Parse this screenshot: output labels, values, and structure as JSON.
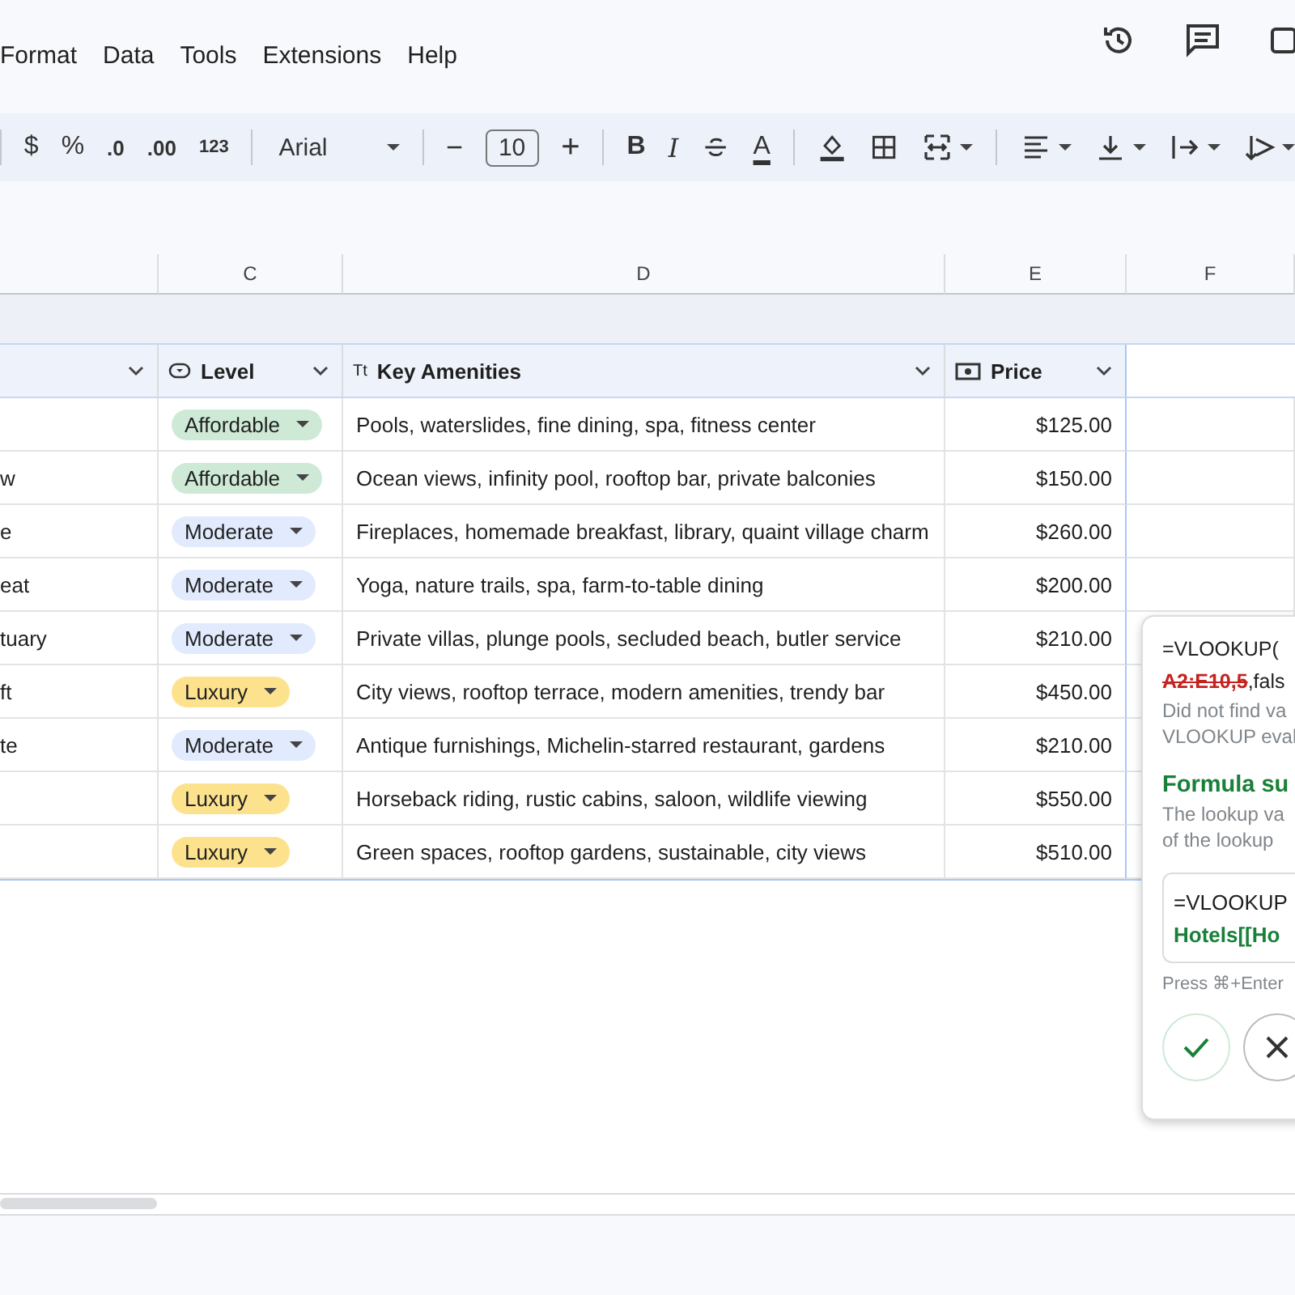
{
  "menu": [
    "Format",
    "Data",
    "Tools",
    "Extensions",
    "Help"
  ],
  "toolbar": {
    "currency": "$",
    "percent": "%",
    "decrease_decimal": ".0",
    "increase_decimal": ".00",
    "more_formats": "123",
    "font": "Arial",
    "size_minus": "−",
    "font_size": "10",
    "size_plus": "+",
    "bold": "B",
    "italic": "I",
    "text_color": "A"
  },
  "column_letters": [
    "C",
    "D",
    "E",
    "F"
  ],
  "table": {
    "headers": [
      {
        "kind": "blank"
      },
      {
        "kind": "dropdown",
        "label": "Level"
      },
      {
        "kind": "text",
        "icon_text": "Tt",
        "label": "Key Amenities"
      },
      {
        "kind": "money",
        "label": "Price"
      }
    ],
    "rows": [
      {
        "level": {
          "label": "Affordable",
          "color": "#ceead6"
        },
        "amenities": "Pools, waterslides, fine dining, spa, fitness center",
        "price": "$125.00"
      },
      {
        "name": "w",
        "level": {
          "label": "Affordable",
          "color": "#ceead6"
        },
        "amenities": "Ocean views, infinity pool, rooftop bar, private balconies",
        "price": "$150.00"
      },
      {
        "name": "e",
        "level": {
          "label": "Moderate",
          "color": "#e1ebfd"
        },
        "amenities": "Fireplaces, homemade breakfast, library, quaint village charm",
        "price": "$260.00"
      },
      {
        "name": "eat",
        "level": {
          "label": "Moderate",
          "color": "#e1ebfd"
        },
        "amenities": "Yoga, nature trails, spa, farm-to-table dining",
        "price": "$200.00"
      },
      {
        "name": "tuary",
        "level": {
          "label": "Moderate",
          "color": "#e1ebfd"
        },
        "amenities": "Private villas, plunge pools, secluded beach, butler service",
        "price": "$210.00"
      },
      {
        "name": "ft",
        "level": {
          "label": "Luxury",
          "color": "#fde28e"
        },
        "amenities": "City views, rooftop terrace, modern amenities, trendy bar",
        "price": "$450.00"
      },
      {
        "name": "te",
        "level": {
          "label": "Moderate",
          "color": "#e1ebfd"
        },
        "amenities": "Antique furnishings, Michelin-starred restaurant, gardens",
        "price": "$210.00"
      },
      {
        "level": {
          "label": "Luxury",
          "color": "#fde28e"
        },
        "amenities": "Horseback riding, rustic cabins, saloon, wildlife viewing",
        "price": "$550.00"
      },
      {
        "level": {
          "label": "Luxury",
          "color": "#fde28e"
        },
        "amenities": "Green spaces, rooftop gardens, sustainable, city views",
        "price": "$510.00"
      }
    ]
  },
  "popup": {
    "formula_start": "=VLOOKUP(",
    "removed": "A2:E10,5",
    "formula_rest": ",fals",
    "error_lines": [
      "Did not find va",
      "VLOOKUP eval"
    ],
    "title": "Formula su",
    "description_lines": [
      "The lookup va",
      "of the lookup"
    ],
    "suggestion_start": "=VLOOKUP",
    "suggestion_added": "Hotels[[Ho",
    "hint": "Press ⌘+Enter"
  }
}
